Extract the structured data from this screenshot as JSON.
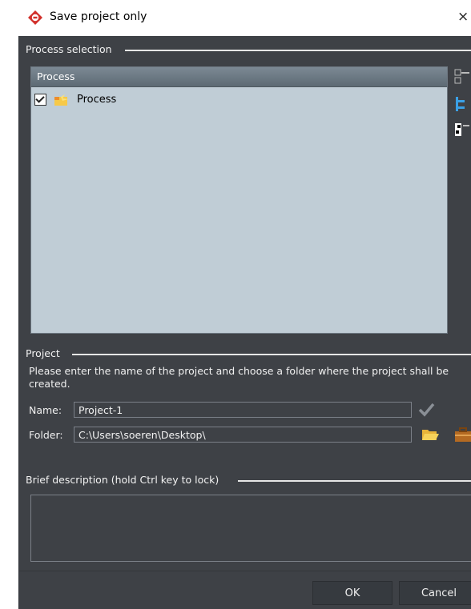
{
  "window": {
    "title": "Save project only",
    "close_glyph": "×"
  },
  "process_selection": {
    "section_title": "Process selection",
    "column_header": "Process",
    "items": [
      {
        "label": "Process",
        "checked": true
      }
    ]
  },
  "project": {
    "section_title": "Project",
    "instructions": "Please enter the name of the project and choose a folder where the project shall be created.",
    "name_label": "Name:",
    "name_value": "Project-1",
    "folder_label": "Folder:",
    "folder_value": "C:\\Users\\soeren\\Desktop\\"
  },
  "description": {
    "section_title": "Brief description (hold Ctrl key to lock)",
    "value": ""
  },
  "buttons": {
    "ok": "OK",
    "cancel": "Cancel"
  },
  "colors": {
    "dialog_bg": "#3e4146",
    "list_bg": "#c0cdd6",
    "accent_red": "#d2302b"
  }
}
